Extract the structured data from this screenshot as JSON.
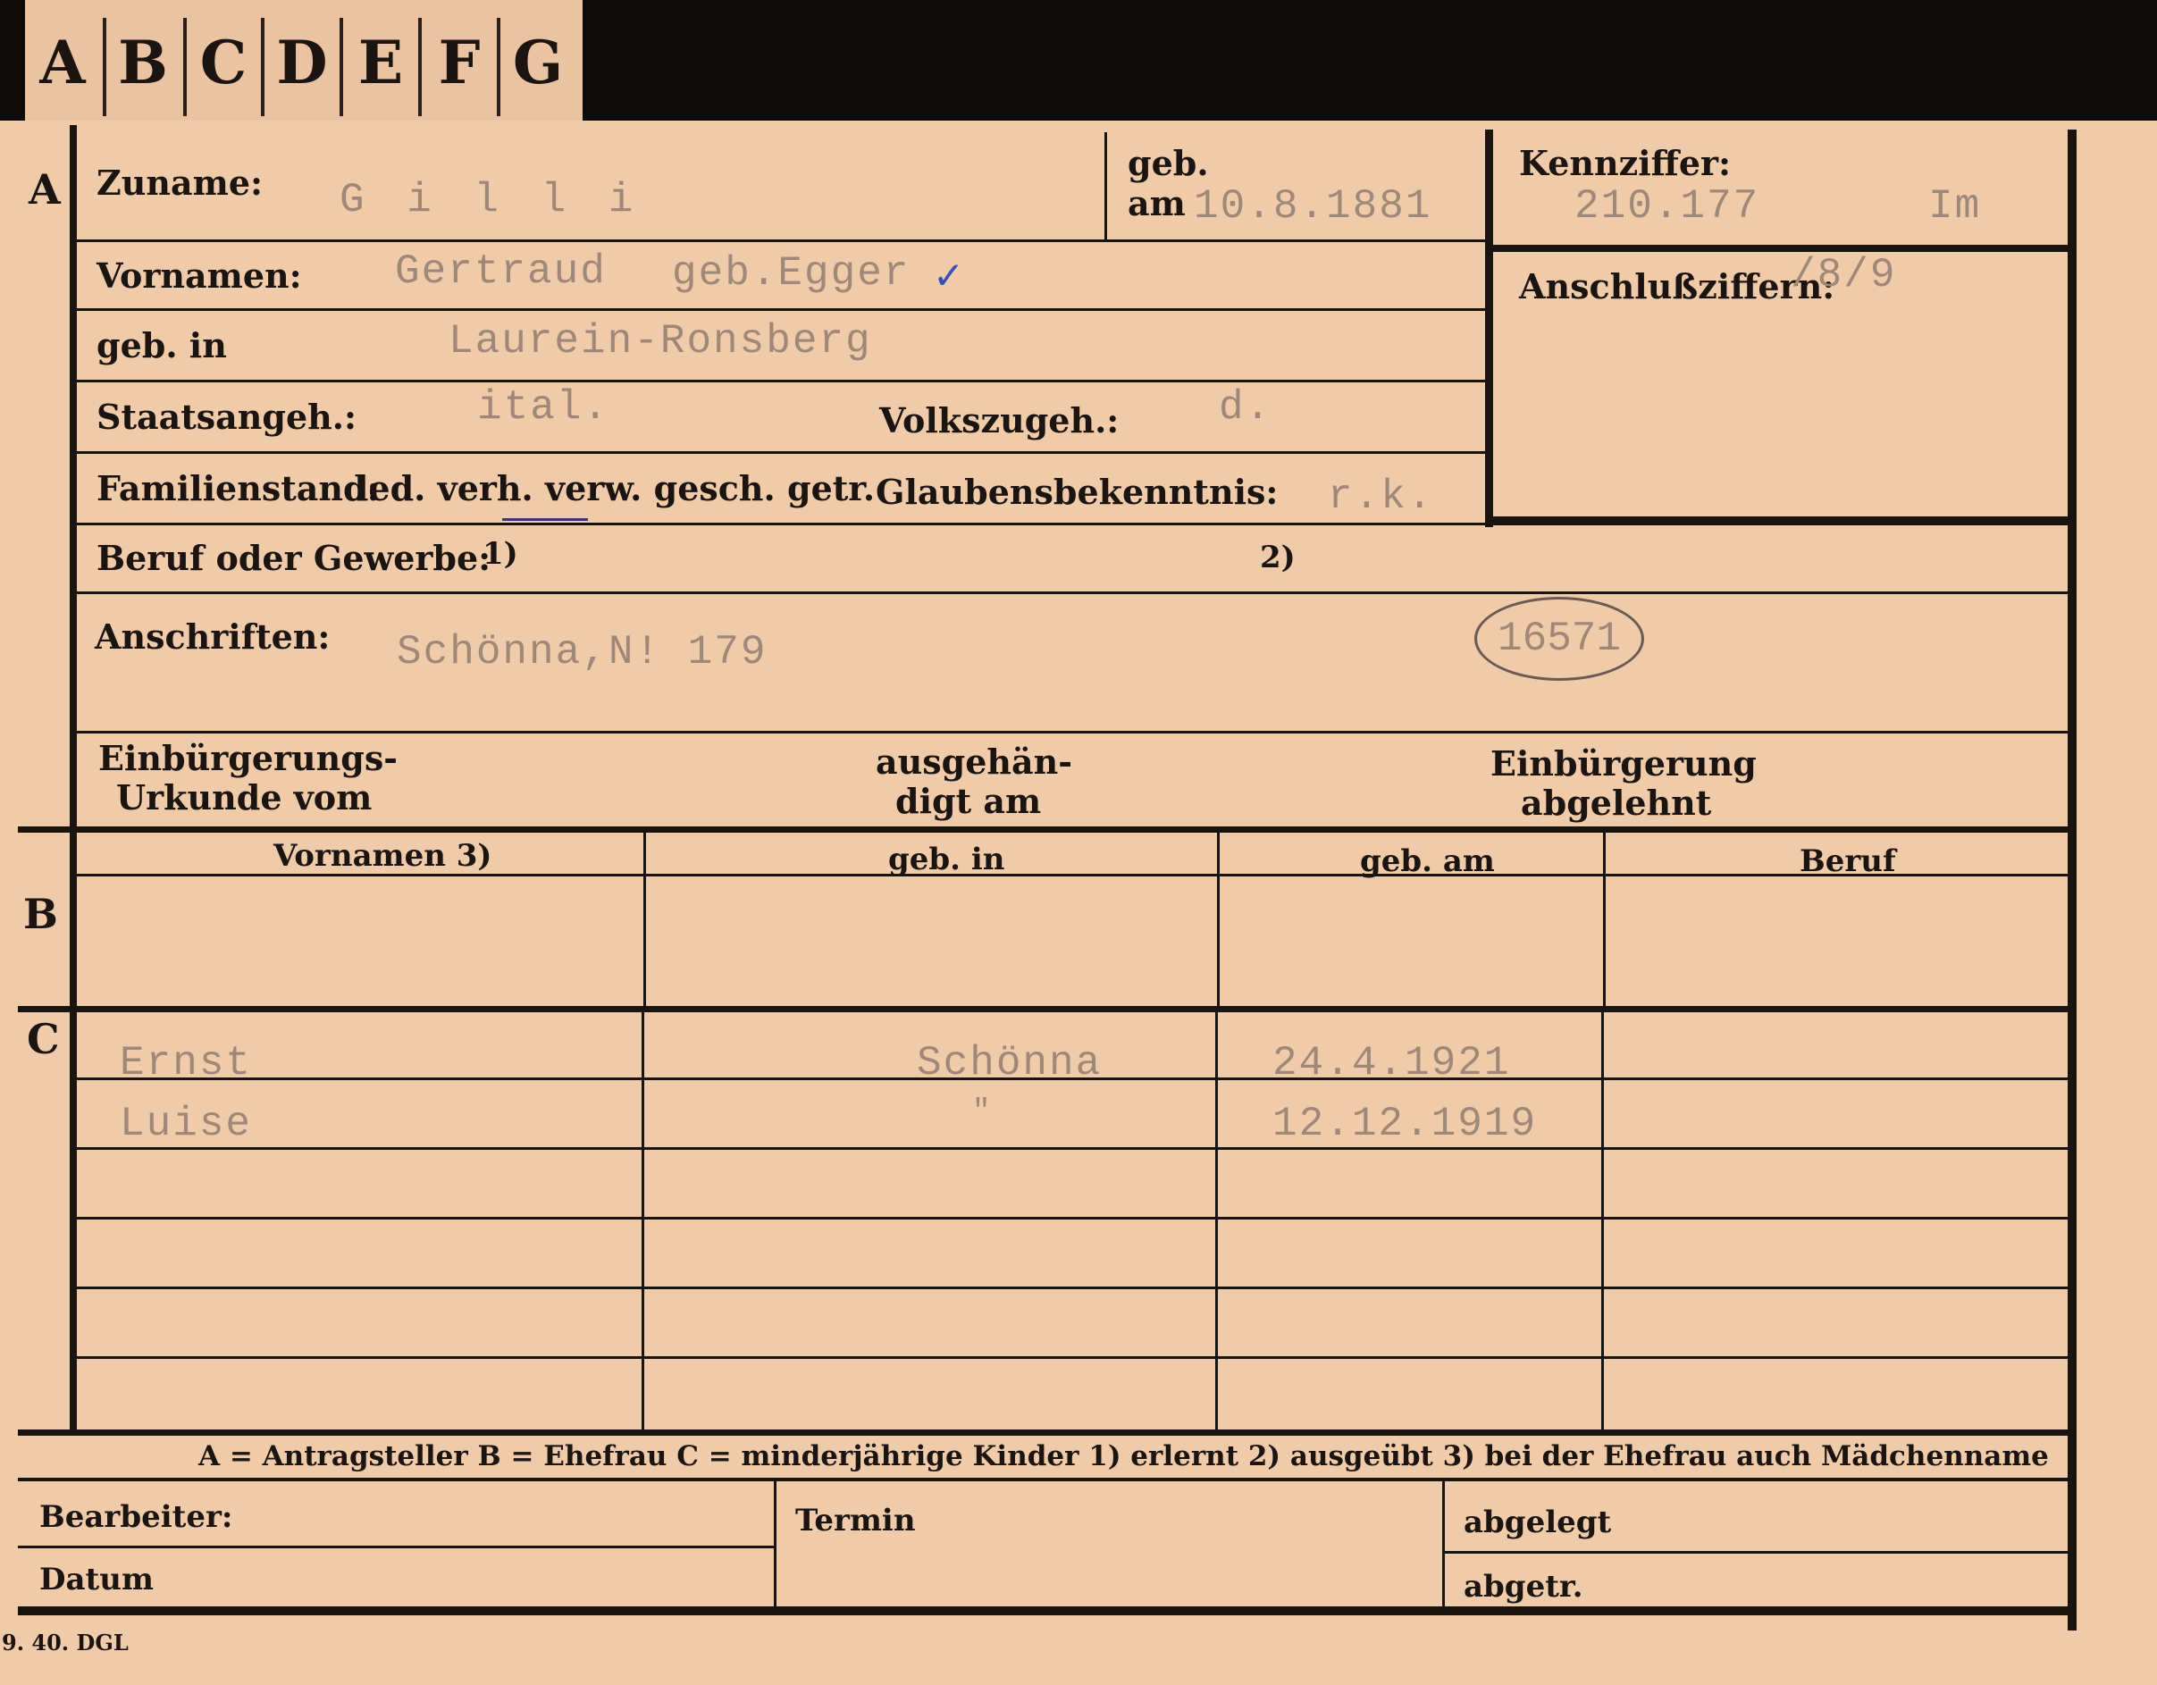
{
  "tabs": [
    "A",
    "B",
    "C",
    "D",
    "E",
    "F",
    "G"
  ],
  "section_letters": {
    "a": "A",
    "b": "B",
    "c": "C"
  },
  "a": {
    "zuname_label": "Zuname:",
    "zuname_value": "G i l l i",
    "geb_label": "geb.",
    "am_label": "am",
    "geb_am_value": "10.8.1881",
    "kennziffer_label": "Kennziffer:",
    "kennziffer_value": "210.177",
    "kennziffer_mark": "Im",
    "vornamen_label": "Vornamen:",
    "vornamen_value": "Gertraud",
    "geb_name_value": "geb.Egger",
    "check_mark": "✓",
    "anschluss_label": "Anschlußziffern:",
    "anschluss_value": "/8/9",
    "geb_in_label": "geb. in",
    "geb_in_value": "Laurein-Ronsberg",
    "staats_label": "Staatsangeh.:",
    "staats_value": "ital.",
    "volks_label": "Volkszugeh.:",
    "volks_value": "d.",
    "familien_label": "Familienstand:",
    "familien_options": "led. verh. verw. gesch. getr.",
    "glaubens_label": "Glaubensbekenntnis:",
    "glaubens_value": "r.k.",
    "beruf_label": "Beruf oder Gewerbe:",
    "beruf_fn1": "1)",
    "beruf_fn2": "2)",
    "anschriften_label": "Anschriften:",
    "anschriften_value": "Schönna,N! 179",
    "stamp_number": "16571",
    "einb_urkunde_label_1": "Einbürgerungs-",
    "einb_urkunde_label_2": "Urkunde vom",
    "ausgehaendigt_label_1": "ausgehän-",
    "ausgehaendigt_label_2": "digt am",
    "einb_abgelehnt_label_1": "Einbürgerung",
    "einb_abgelehnt_label_2": "abgelehnt"
  },
  "b": {
    "headers": [
      "Vornamen 3)",
      "geb. in",
      "geb. am",
      "Beruf"
    ]
  },
  "c": {
    "rows": [
      {
        "name": "Ernst",
        "place": "Schönna",
        "date": "24.4.1921"
      },
      {
        "name": "Luise",
        "place": "\"",
        "date": "12.12.1919"
      }
    ]
  },
  "legend": "A = Antragsteller   B = Ehefrau   C = minderjährige Kinder   1) erlernt   2) ausgeübt   3) bei der Ehefrau auch Mädchenname",
  "footer": {
    "bearbeiter_label": "Bearbeiter:",
    "datum_label": "Datum",
    "termin_label": "Termin",
    "abgelegt_label": "abgelegt",
    "abgetr_label": "abgetr."
  },
  "imprint": "9. 40. DGL"
}
